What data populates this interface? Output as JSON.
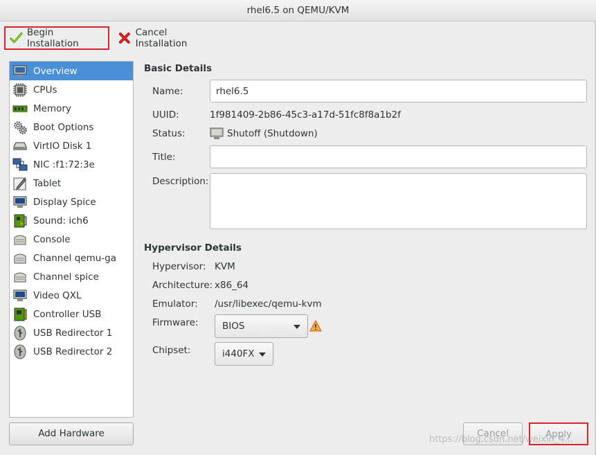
{
  "window": {
    "title": "rhel6.5 on QEMU/KVM"
  },
  "toolbar": {
    "begin_label": "Begin Installation",
    "cancel_label": "Cancel Installation"
  },
  "sidebar": {
    "items": [
      {
        "label": "Overview",
        "icon": "monitor-icon"
      },
      {
        "label": "CPUs",
        "icon": "cpu-icon"
      },
      {
        "label": "Memory",
        "icon": "memory-icon"
      },
      {
        "label": "Boot Options",
        "icon": "gears-icon"
      },
      {
        "label": "VirtIO Disk 1",
        "icon": "disk-icon"
      },
      {
        "label": "NIC :f1:72:3e",
        "icon": "network-icon"
      },
      {
        "label": "Tablet",
        "icon": "tablet-icon"
      },
      {
        "label": "Display Spice",
        "icon": "display-icon"
      },
      {
        "label": "Sound: ich6",
        "icon": "sound-card-icon"
      },
      {
        "label": "Console",
        "icon": "serial-icon"
      },
      {
        "label": "Channel qemu-ga",
        "icon": "serial-icon"
      },
      {
        "label": "Channel spice",
        "icon": "serial-icon"
      },
      {
        "label": "Video QXL",
        "icon": "display-icon"
      },
      {
        "label": "Controller USB",
        "icon": "controller-icon"
      },
      {
        "label": "USB Redirector 1",
        "icon": "usb-icon"
      },
      {
        "label": "USB Redirector 2",
        "icon": "usb-icon"
      }
    ],
    "add_hardware_label": "Add Hardware"
  },
  "basic": {
    "heading": "Basic Details",
    "name_label": "Name:",
    "name_value": "rhel6.5",
    "uuid_label": "UUID:",
    "uuid_value": "1f981409-2b86-45c3-a17d-51fc8f8a1b2f",
    "status_label": "Status:",
    "status_value": "Shutoff (Shutdown)",
    "title_label": "Title:",
    "title_value": "",
    "description_label": "Description:",
    "description_value": ""
  },
  "hypervisor": {
    "heading": "Hypervisor Details",
    "hypervisor_label": "Hypervisor:",
    "hypervisor_value": "KVM",
    "arch_label": "Architecture:",
    "arch_value": "x86_64",
    "emulator_label": "Emulator:",
    "emulator_value": "/usr/libexec/qemu-kvm",
    "firmware_label": "Firmware:",
    "firmware_value": "BIOS",
    "chipset_label": "Chipset:",
    "chipset_value": "i440FX"
  },
  "actions": {
    "cancel_label": "Cancel",
    "apply_label": "Apply"
  },
  "watermark": "https://blog.csdn.net/weixin_4..."
}
